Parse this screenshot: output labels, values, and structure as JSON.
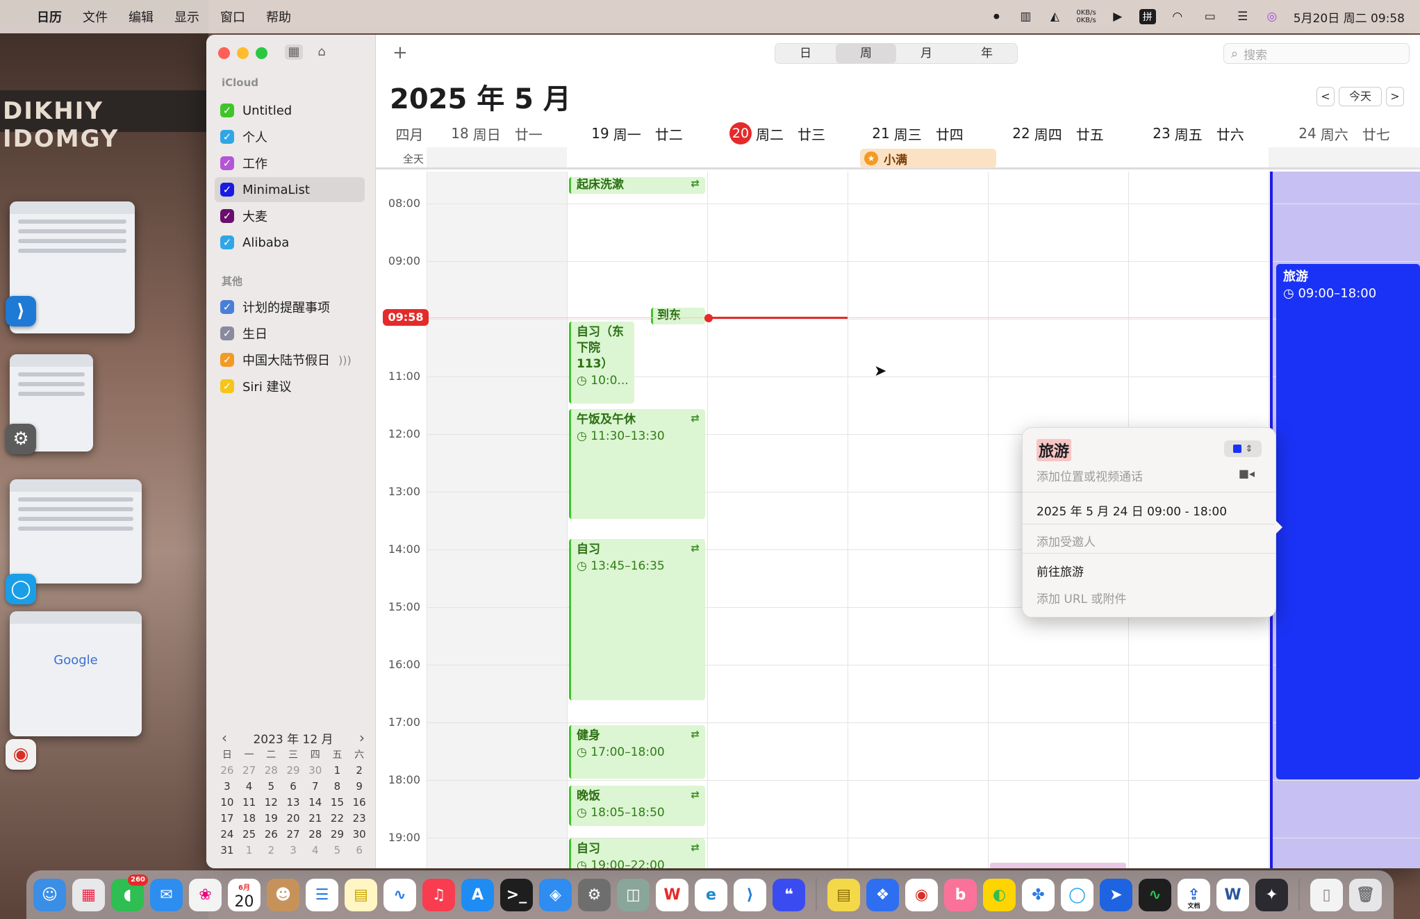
{
  "menubar": {
    "app_name": "日历",
    "menus": [
      "文件",
      "编辑",
      "显示",
      "窗口",
      "帮助"
    ],
    "netspeed_up": "0KB/s",
    "netspeed_down": "0KB/s",
    "input_method": "拼",
    "datetime": "5月20日 周二 09:58"
  },
  "desktop": {
    "wallpaper_text": "DIKHIY   IDOMGY",
    "thumbnail_google": "Google"
  },
  "sidebar": {
    "section_icloud": "iCloud",
    "icloud_calendars": [
      {
        "name": "Untitled",
        "color": "#3fc42a"
      },
      {
        "name": "个人",
        "color": "#30a6e6"
      },
      {
        "name": "工作",
        "color": "#b455d6"
      },
      {
        "name": "MinimaList",
        "color": "#1a1ae0"
      },
      {
        "name": "大麦",
        "color": "#6a0f6e"
      },
      {
        "name": "Alibaba",
        "color": "#30a6e6"
      }
    ],
    "section_other": "其他",
    "other_calendars": [
      {
        "name": "计划的提醒事项",
        "color": "#4a7fd6"
      },
      {
        "name": "生日",
        "color": "#8a8a9e"
      },
      {
        "name": "中国大陆节假日",
        "color": "#f39a24"
      },
      {
        "name": "Siri 建议",
        "color": "#f5c518"
      }
    ],
    "selected_calendar": "MinimaList"
  },
  "mini_calendar": {
    "title": "2023 年 12 月",
    "weekdays": [
      "日",
      "一",
      "二",
      "三",
      "四",
      "五",
      "六"
    ],
    "weeks": [
      [
        "26",
        "27",
        "28",
        "29",
        "30",
        "1",
        "2"
      ],
      [
        "3",
        "4",
        "5",
        "6",
        "7",
        "8",
        "9"
      ],
      [
        "10",
        "11",
        "12",
        "13",
        "14",
        "15",
        "16"
      ],
      [
        "17",
        "18",
        "19",
        "20",
        "21",
        "22",
        "23"
      ],
      [
        "24",
        "25",
        "26",
        "27",
        "28",
        "29",
        "30"
      ],
      [
        "31",
        "1",
        "2",
        "3",
        "4",
        "5",
        "6"
      ]
    ]
  },
  "toolbar": {
    "add_label": "+",
    "views": [
      "日",
      "周",
      "月",
      "年"
    ],
    "active_view": "周",
    "search_placeholder": "搜索"
  },
  "header": {
    "title": "2025 年 5 月",
    "today_label": "今天",
    "prev_label": "<",
    "next_label": ">"
  },
  "week": {
    "month_label": "四月",
    "allday_label": "全天",
    "days": [
      {
        "date": "18",
        "dow": "周日",
        "lunar": "廿一"
      },
      {
        "date": "19",
        "dow": "周一",
        "lunar": "廿二"
      },
      {
        "date": "20",
        "dow": "周二",
        "lunar": "廿三"
      },
      {
        "date": "21",
        "dow": "周三",
        "lunar": "廿四"
      },
      {
        "date": "22",
        "dow": "周四",
        "lunar": "廿五"
      },
      {
        "date": "23",
        "dow": "周五",
        "lunar": "廿六"
      },
      {
        "date": "24",
        "dow": "周六",
        "lunar": "廿七"
      }
    ],
    "today_index": 2,
    "hours": [
      "08:00",
      "09:00",
      "11:00",
      "12:00",
      "13:00",
      "14:00",
      "15:00",
      "16:00",
      "17:00",
      "18:00",
      "19:00"
    ],
    "allday_events": [
      {
        "title": "小满",
        "day": 3
      }
    ],
    "now_label": "09:58"
  },
  "events": [
    {
      "title": "起床洗漱",
      "time": ""
    },
    {
      "title": "到东下…",
      "time": ""
    },
    {
      "title": "自习（东下院113）",
      "time": "10:0..."
    },
    {
      "title": "午饭及午休",
      "time": "11:30–13:30"
    },
    {
      "title": "自习",
      "time": "13:45–16:35"
    },
    {
      "title": "健身",
      "time": "17:00–18:00"
    },
    {
      "title": "晚饭",
      "time": "18:05–18:50"
    },
    {
      "title": "自习",
      "time": "19:00–22:00"
    },
    {
      "title": "旅游",
      "time": "09:00–18:00"
    }
  ],
  "popover": {
    "title": "旅游",
    "location_placeholder": "添加位置或视频通话",
    "date_range": "2025 年 5 月 24 日  09:00 - 18:00",
    "invitees_placeholder": "添加受邀人",
    "go_to": "前往旅游",
    "url_placeholder": "添加 URL 或附件"
  },
  "dock": {
    "calendar_month": "6月",
    "calendar_day": "20",
    "messages_badge": "260",
    "file_label": "文档"
  }
}
